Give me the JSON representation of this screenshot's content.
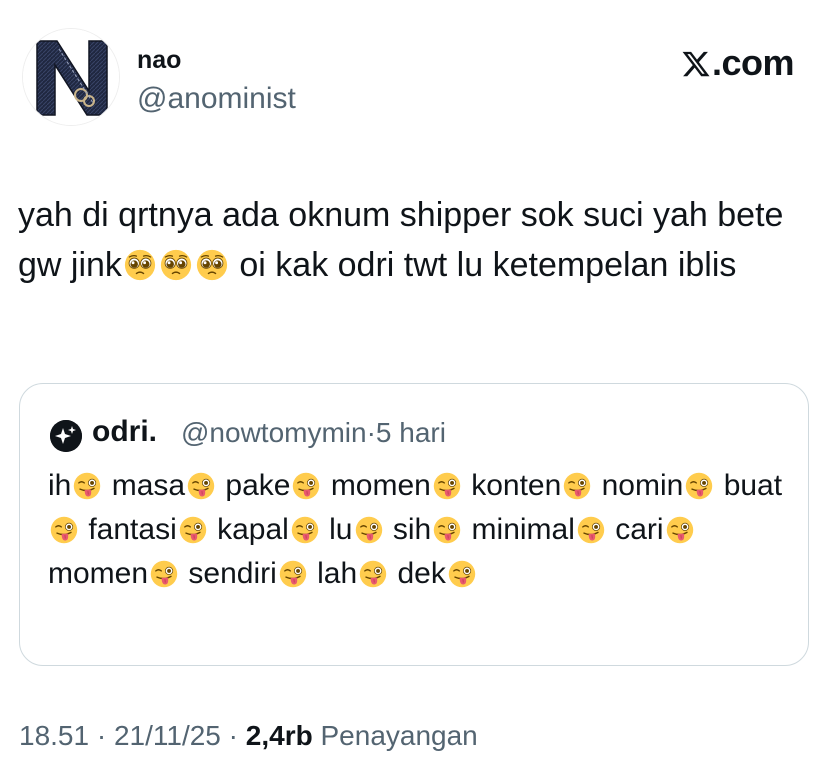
{
  "header": {
    "display_name": "nao",
    "handle": "@anominist",
    "brand": ".com",
    "avatar_letter": "N"
  },
  "tweet": {
    "text_parts": [
      "yah di qrtnya ada oknum shipper sok suci yah bete gw jink",
      "pleading-face-emoji",
      "pleading-face-emoji",
      "pleading-face-emoji",
      " oi kak odri twt lu ketempelan iblis"
    ]
  },
  "quote": {
    "name": "odri.",
    "handle": "@nowtomymin",
    "separator": "·",
    "time": "5 hari",
    "words": [
      "ih",
      "masa",
      "pake",
      "momen",
      "konten",
      "nomin",
      "buat",
      "fantasi",
      "kapal",
      "lu",
      "sih",
      "minimal",
      "cari",
      "momen",
      "sendiri",
      "lah",
      "dek"
    ],
    "emoji": "winking-face-with-tongue-emoji"
  },
  "footer": {
    "time": "18.51",
    "date": "21/11/25",
    "separator": "·",
    "views_count": "2,4rb",
    "views_label": "Penayangan"
  },
  "colors": {
    "text": "#0f1419",
    "secondary": "#536471",
    "border": "#cfd9de",
    "emoji_yellow": "#ffcc4d"
  }
}
